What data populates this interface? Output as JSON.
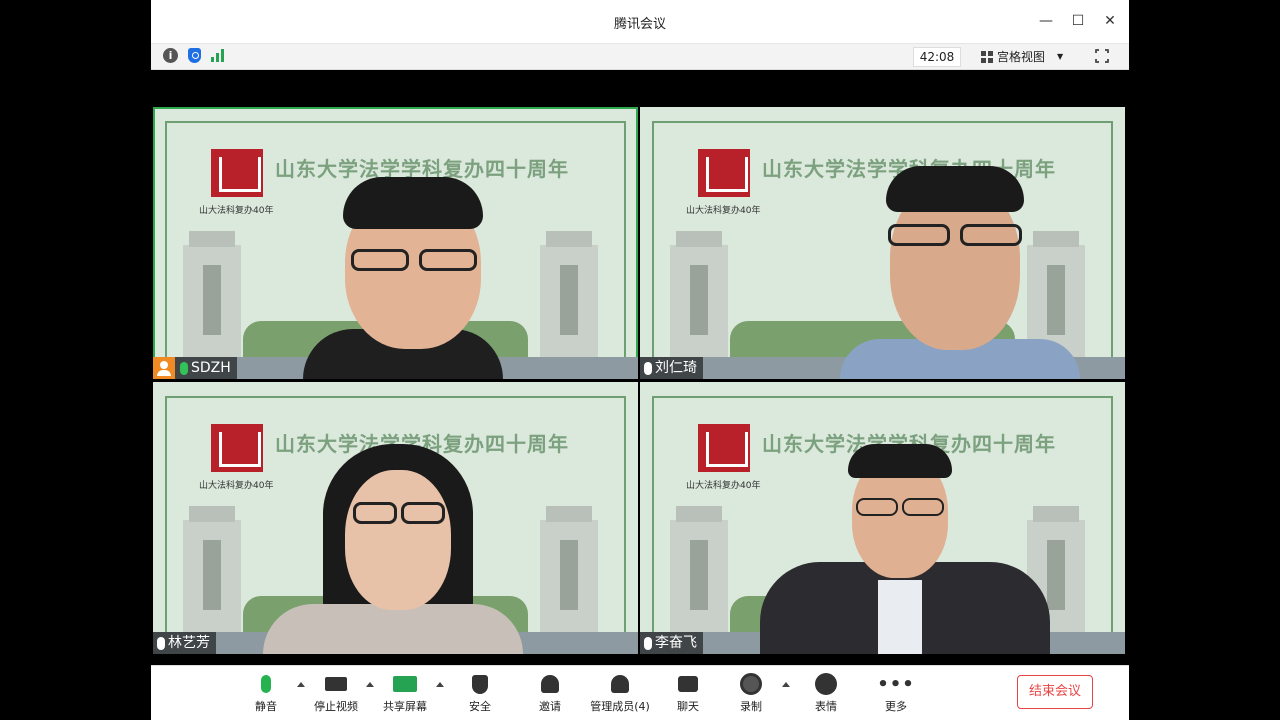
{
  "window": {
    "title": "腾讯会议"
  },
  "infobar": {
    "timer": "42:08",
    "view_label": "宫格视图"
  },
  "tiles": [
    {
      "name": "SDZH",
      "banner": "山东大学法学学科复办四十周年",
      "logo_caption": "山大法科复办40年",
      "host": true
    },
    {
      "name": "刘仁琦",
      "banner": "山东大学法学学科复办四十周年",
      "logo_caption": "山大法科复办40年",
      "host": false
    },
    {
      "name": "林艺芳",
      "banner": "山东大学法学学科复办四十周年",
      "logo_caption": "山大法科复办40年",
      "host": false
    },
    {
      "name": "李奋飞",
      "banner": "山东大学法学学科复办四十周年",
      "logo_caption": "山大法科复办40年",
      "host": false
    }
  ],
  "toolbar": {
    "mute": "静音",
    "stop_video": "停止视频",
    "share_screen": "共享屏幕",
    "security": "安全",
    "invite": "邀请",
    "manage_members": "管理成员(4)",
    "chat": "聊天",
    "record": "录制",
    "reactions": "表情",
    "more": "更多",
    "end_meeting": "结束会议"
  },
  "colors": {
    "accent_green": "#2ea84d",
    "end_red": "#e84545",
    "host_orange": "#f08a24"
  }
}
